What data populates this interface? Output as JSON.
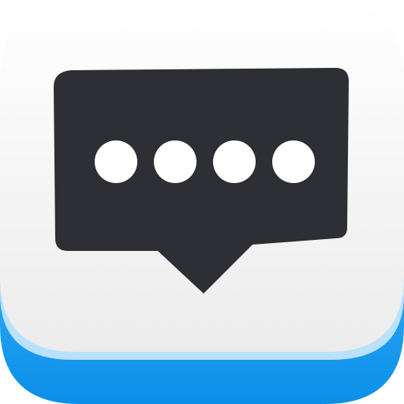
{
  "icon": {
    "name": "chat-bubble-icon",
    "dot_count": 4
  },
  "colors": {
    "tile_top": "#ffffff",
    "tile_bottom": "#ececec",
    "edge_highlight": "#b9e1fb",
    "base_blue_light": "#2aa6f5",
    "base_blue_dark": "#0a8fe8",
    "bubble": "#2d2f34",
    "dots": "#ffffff"
  }
}
